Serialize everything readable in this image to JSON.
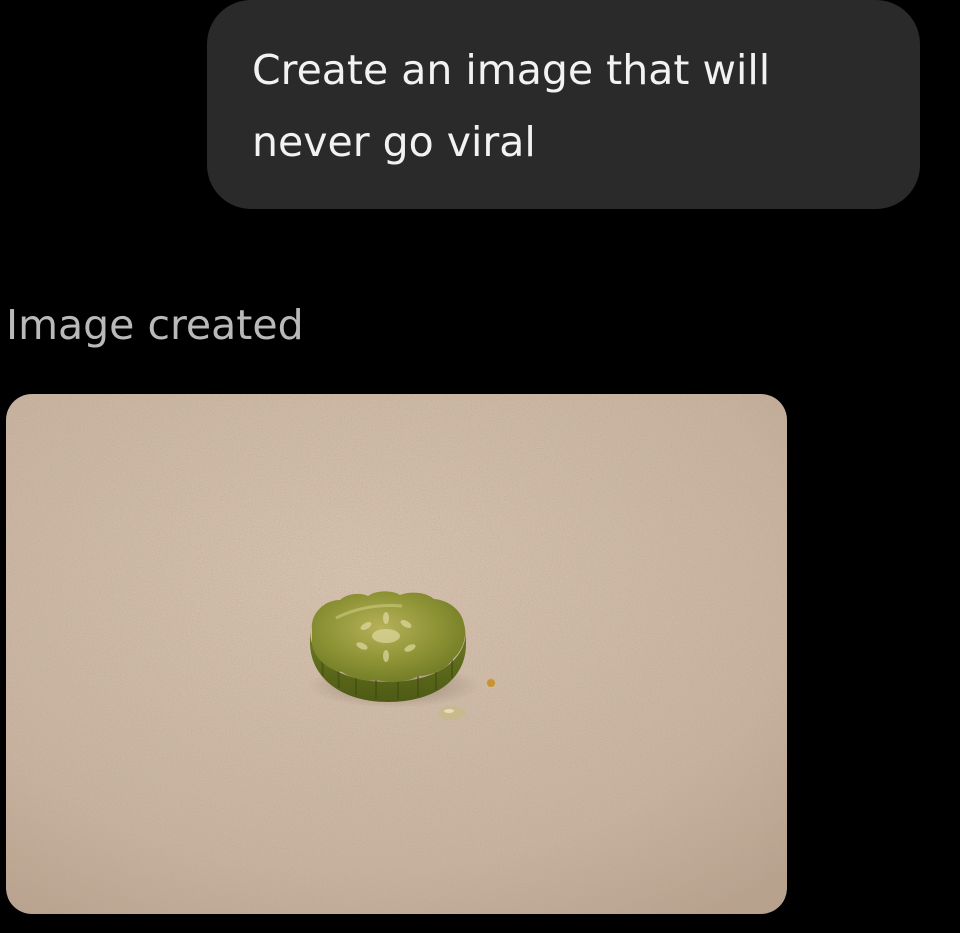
{
  "conversation": {
    "user_message": "Create an image that will never go viral",
    "assistant_status": "Image created"
  },
  "generated_image": {
    "subject": "pickle-slice-on-countertop"
  },
  "colors": {
    "background": "#000000",
    "user_bubble": "#2a2a2a",
    "user_text": "#f2f2f2",
    "status_text": "#b9b9b9",
    "countertop": "#cdb7a4",
    "pickle": "#7e8a2a"
  }
}
